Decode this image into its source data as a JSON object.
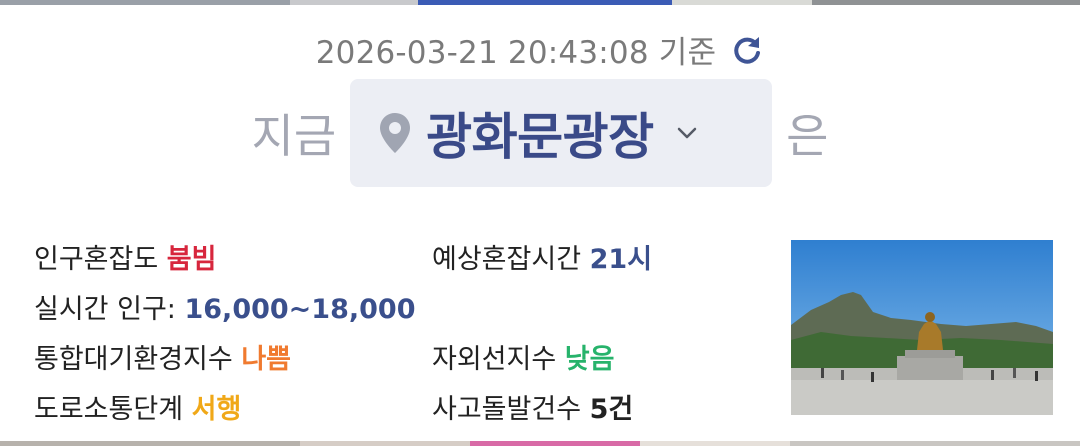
{
  "header": {
    "timestamp": "2026-03-21 20:43:08 기준",
    "refresh_icon": "refresh-icon"
  },
  "location": {
    "prefix": "지금",
    "name": "광화문광장",
    "suffix": "은",
    "pin_icon": "map-pin-icon",
    "dropdown_icon": "chevron-down-icon"
  },
  "info": {
    "congestion_label": "인구혼잡도",
    "congestion_value": "붐빔",
    "forecast_label": "예상혼잡시간",
    "forecast_value": "21시",
    "population_label": "실시간 인구:",
    "population_value": "16,000~18,000",
    "air_label": "통합대기환경지수",
    "air_value": "나쁨",
    "uv_label": "자외선지수",
    "uv_value": "낮음",
    "traffic_label": "도로소통단계",
    "traffic_value": "서행",
    "accident_label": "사고돌발건수",
    "accident_value": "5건"
  },
  "colors": {
    "crowded": "#d7263d",
    "forecast": "#3a4f8c",
    "population": "#3a4f8c",
    "air_bad": "#f07a2f",
    "uv_low": "#27b36b",
    "traffic_slow": "#f0a818",
    "accident": "#222222"
  }
}
